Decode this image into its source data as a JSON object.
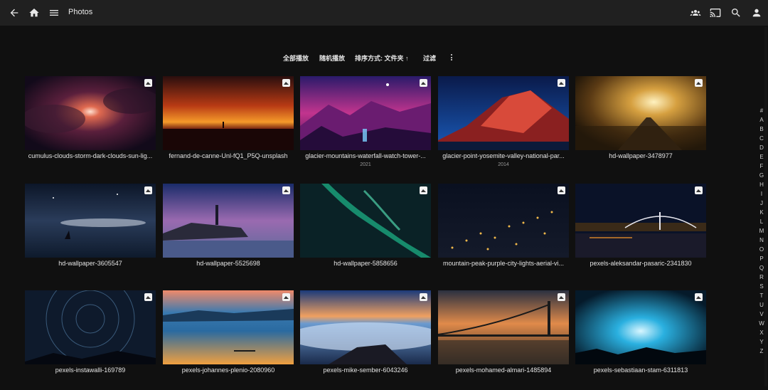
{
  "header": {
    "title": "Photos",
    "icons": [
      "back-arrow-icon",
      "home-icon",
      "menu-icon",
      "users-icon",
      "cast-icon",
      "search-icon",
      "user-icon"
    ]
  },
  "toolbar": {
    "play_all": "全部播放",
    "shuffle": "随机播放",
    "sort": "排序方式: 文件夹 ↑",
    "filter": "过滤"
  },
  "photos": [
    {
      "title": "cumulus-clouds-storm-dark-clouds-sun-lig...",
      "year": ""
    },
    {
      "title": "fernand-de-canne-Unl-fQ1_P5Q-unsplash",
      "year": ""
    },
    {
      "title": "glacier-mountains-waterfall-watch-tower-...",
      "year": "2021"
    },
    {
      "title": "glacier-point-yosemite-valley-national-par...",
      "year": "2014"
    },
    {
      "title": "hd-wallpaper-3478977",
      "year": ""
    },
    {
      "title": "hd-wallpaper-3605547",
      "year": ""
    },
    {
      "title": "hd-wallpaper-5525698",
      "year": ""
    },
    {
      "title": "hd-wallpaper-5858656",
      "year": ""
    },
    {
      "title": "mountain-peak-purple-city-lights-aerial-vi...",
      "year": ""
    },
    {
      "title": "pexels-aleksandar-pasaric-2341830",
      "year": ""
    },
    {
      "title": "pexels-instawalli-169789",
      "year": ""
    },
    {
      "title": "pexels-johannes-plenio-2080960",
      "year": ""
    },
    {
      "title": "pexels-mike-sember-6043246",
      "year": ""
    },
    {
      "title": "pexels-mohamed-almari-1485894",
      "year": ""
    },
    {
      "title": "pexels-sebastiaan-stam-6311813",
      "year": ""
    }
  ],
  "alphabet": [
    "#",
    "A",
    "B",
    "C",
    "D",
    "E",
    "F",
    "G",
    "H",
    "I",
    "J",
    "K",
    "L",
    "M",
    "N",
    "O",
    "P",
    "Q",
    "R",
    "S",
    "T",
    "U",
    "V",
    "W",
    "X",
    "Y",
    "Z"
  ],
  "colors": {
    "background": "#101010",
    "header": "#202020",
    "text": "#e6e6e6"
  }
}
